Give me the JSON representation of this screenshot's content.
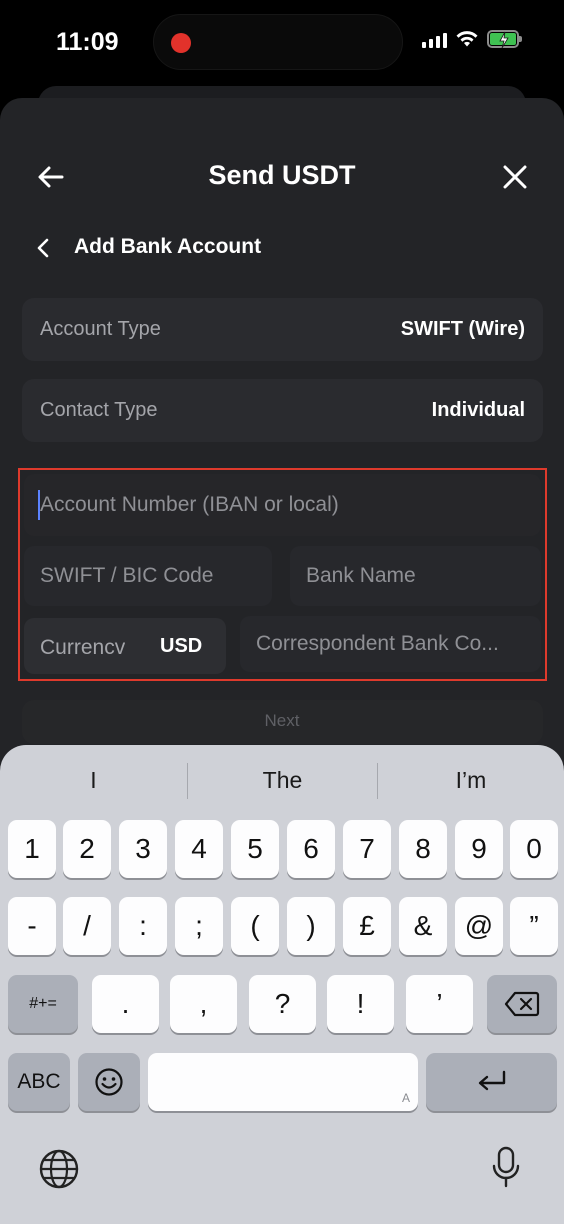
{
  "status_bar": {
    "time": "11:09"
  },
  "header": {
    "title": "Send USDT"
  },
  "subheader": {
    "title": "Add Bank Account"
  },
  "account_type": {
    "label": "Account Type",
    "value": "SWIFT (Wire)"
  },
  "contact_type": {
    "label": "Contact Type",
    "value": "Individual"
  },
  "form": {
    "account_number_placeholder": "Account Number (IBAN or local)",
    "swift_placeholder": "SWIFT / BIC Code",
    "bank_name_placeholder": "Bank Name",
    "currency_label": "Currencv",
    "currency_value": "USD",
    "correspondent_placeholder": "Correspondent Bank Co..."
  },
  "next_button": {
    "label": "Next"
  },
  "keyboard": {
    "suggestions": [
      "I",
      "The",
      "I’m"
    ],
    "row1": [
      "1",
      "2",
      "3",
      "4",
      "5",
      "6",
      "7",
      "8",
      "9",
      "0"
    ],
    "row2": [
      "-",
      "/",
      ":",
      ";",
      "(",
      ")",
      "£",
      "&",
      "@",
      "”"
    ],
    "row3": [
      ".",
      ",",
      "?",
      "!",
      "’"
    ],
    "symbols_key": "#+=",
    "abc_key": "ABC",
    "space_hint": "A"
  }
}
